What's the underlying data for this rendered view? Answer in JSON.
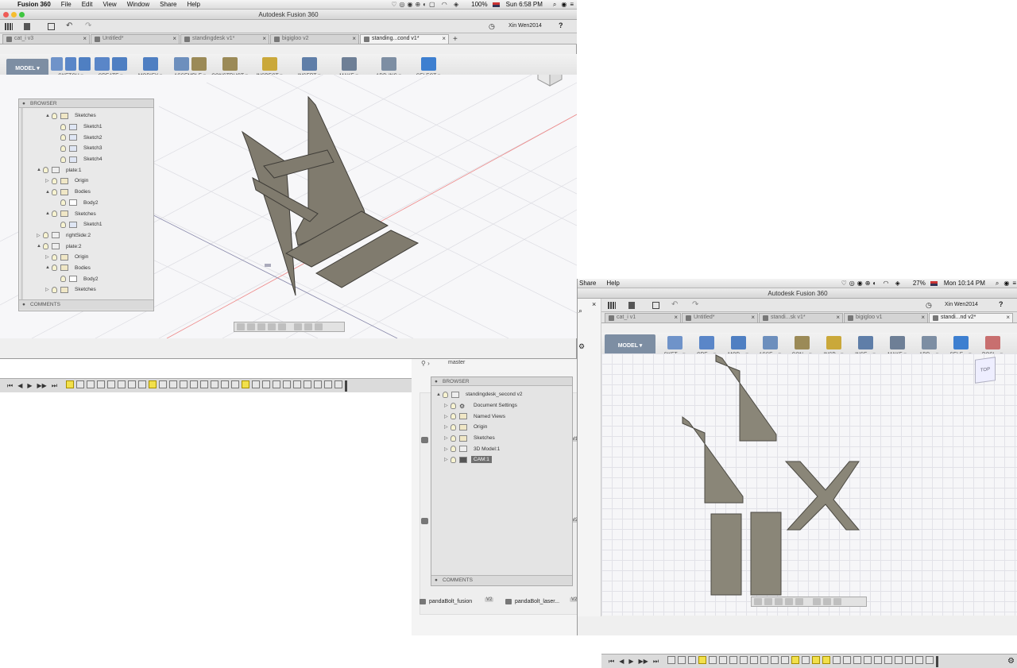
{
  "top_window": {
    "menu": {
      "app_name": "Fusion 360",
      "items": [
        "File",
        "Edit",
        "View",
        "Window",
        "Share",
        "Help"
      ],
      "battery": "100%",
      "clock": "Sun 6:58 PM"
    },
    "title": "Autodesk Fusion 360",
    "user": "Xin Wen2014",
    "help": "?",
    "tabs": [
      {
        "label": "cat_i v3",
        "active": false
      },
      {
        "label": "Untitled*",
        "active": false
      },
      {
        "label": "standingdesk v1*",
        "active": false
      },
      {
        "label": "bigigloo v2",
        "active": false
      },
      {
        "label": "standing...cond v1*",
        "active": true
      }
    ],
    "mode": "MODEL",
    "toolbar_groups": [
      "SKETCH",
      "CREATE",
      "MODIFY",
      "ASSEMBLE",
      "CONSTRUCT",
      "INSPECT",
      "INSERT",
      "MAKE",
      "ADD-INS",
      "SELECT"
    ],
    "browser": {
      "title": "BROWSER",
      "rows": [
        {
          "label": "Sketches",
          "indent": 2,
          "type": "folder",
          "arrow": "▲"
        },
        {
          "label": "Sketch1",
          "indent": 3,
          "type": "sketch",
          "arrow": ""
        },
        {
          "label": "Sketch2",
          "indent": 3,
          "type": "sketch",
          "arrow": ""
        },
        {
          "label": "Sketch3",
          "indent": 3,
          "type": "sketch",
          "arrow": ""
        },
        {
          "label": "Sketch4",
          "indent": 3,
          "type": "sketch",
          "arrow": ""
        },
        {
          "label": "plate:1",
          "indent": 1,
          "type": "component",
          "arrow": "▲"
        },
        {
          "label": "Origin",
          "indent": 2,
          "type": "folder",
          "arrow": "▷"
        },
        {
          "label": "Bodies",
          "indent": 2,
          "type": "folder",
          "arrow": "▲"
        },
        {
          "label": "Body2",
          "indent": 3,
          "type": "body",
          "arrow": ""
        },
        {
          "label": "Sketches",
          "indent": 2,
          "type": "folder",
          "arrow": "▲"
        },
        {
          "label": "Sketch1",
          "indent": 3,
          "type": "sketch",
          "arrow": ""
        },
        {
          "label": "rightSide:2",
          "indent": 1,
          "type": "component",
          "arrow": "▷"
        },
        {
          "label": "plate:2",
          "indent": 1,
          "type": "component",
          "arrow": "▲"
        },
        {
          "label": "Origin",
          "indent": 2,
          "type": "folder",
          "arrow": "▷"
        },
        {
          "label": "Bodies",
          "indent": 2,
          "type": "folder",
          "arrow": "▲"
        },
        {
          "label": "Body2",
          "indent": 3,
          "type": "body",
          "arrow": ""
        },
        {
          "label": "Sketches",
          "indent": 2,
          "type": "folder",
          "arrow": "▷"
        }
      ],
      "comments": "COMMENTS"
    }
  },
  "bottom_window": {
    "menu": {
      "items": [
        "Share",
        "Help"
      ],
      "battery": "27%",
      "clock": "Mon 10:14 PM"
    },
    "title": "Autodesk Fusion 360",
    "user": "Xin Wen2014",
    "help": "?",
    "tabs": [
      {
        "label": "cat_i v1",
        "active": false
      },
      {
        "label": "Untitled*",
        "active": false
      },
      {
        "label": "standi...sk v1*",
        "active": false
      },
      {
        "label": "bigigloo v1",
        "active": false
      },
      {
        "label": "standi...nd v2*",
        "active": true
      }
    ],
    "mode": "MODEL",
    "toolbar_groups": [
      "SKET...",
      "CRE...",
      "MOD...",
      "ASSE...",
      "CON...",
      "INSP...",
      "INSE...",
      "MAKE",
      "ADD...",
      "SELE...",
      "POSI..."
    ],
    "view_cube_label": "TOP"
  },
  "data_panel": {
    "branch": "master",
    "browser_title": "BROWSER",
    "rows": [
      {
        "label": "standingdesk_second v2",
        "indent": 0,
        "arrow": "▲",
        "type": "component"
      },
      {
        "label": "Document Settings",
        "indent": 1,
        "arrow": "▷",
        "type": "gear"
      },
      {
        "label": "Named Views",
        "indent": 1,
        "arrow": "▷",
        "type": "folder"
      },
      {
        "label": "Origin",
        "indent": 1,
        "arrow": "▷",
        "type": "folder"
      },
      {
        "label": "Sketches",
        "indent": 1,
        "arrow": "▷",
        "type": "folder"
      },
      {
        "label": "3D Model:1",
        "indent": 1,
        "arrow": "▷",
        "type": "component"
      },
      {
        "label": "CAM:1",
        "indent": 1,
        "arrow": "▷",
        "type": "component",
        "selected": true
      }
    ],
    "comments": "COMMENTS",
    "cards": [
      {
        "label": "pandaBolt_fusion",
        "version": "V2"
      },
      {
        "label": "pandaBolt_laser...",
        "version": "V2"
      }
    ],
    "side_badges": [
      "V1",
      "V2"
    ]
  },
  "colors": {
    "panel_fill": "#8a8678",
    "panel_stroke": "#4c4a43",
    "mode_button": "#7d8ea3",
    "selected_row": "#707070",
    "timeline_highlight": "#f2e04b"
  }
}
